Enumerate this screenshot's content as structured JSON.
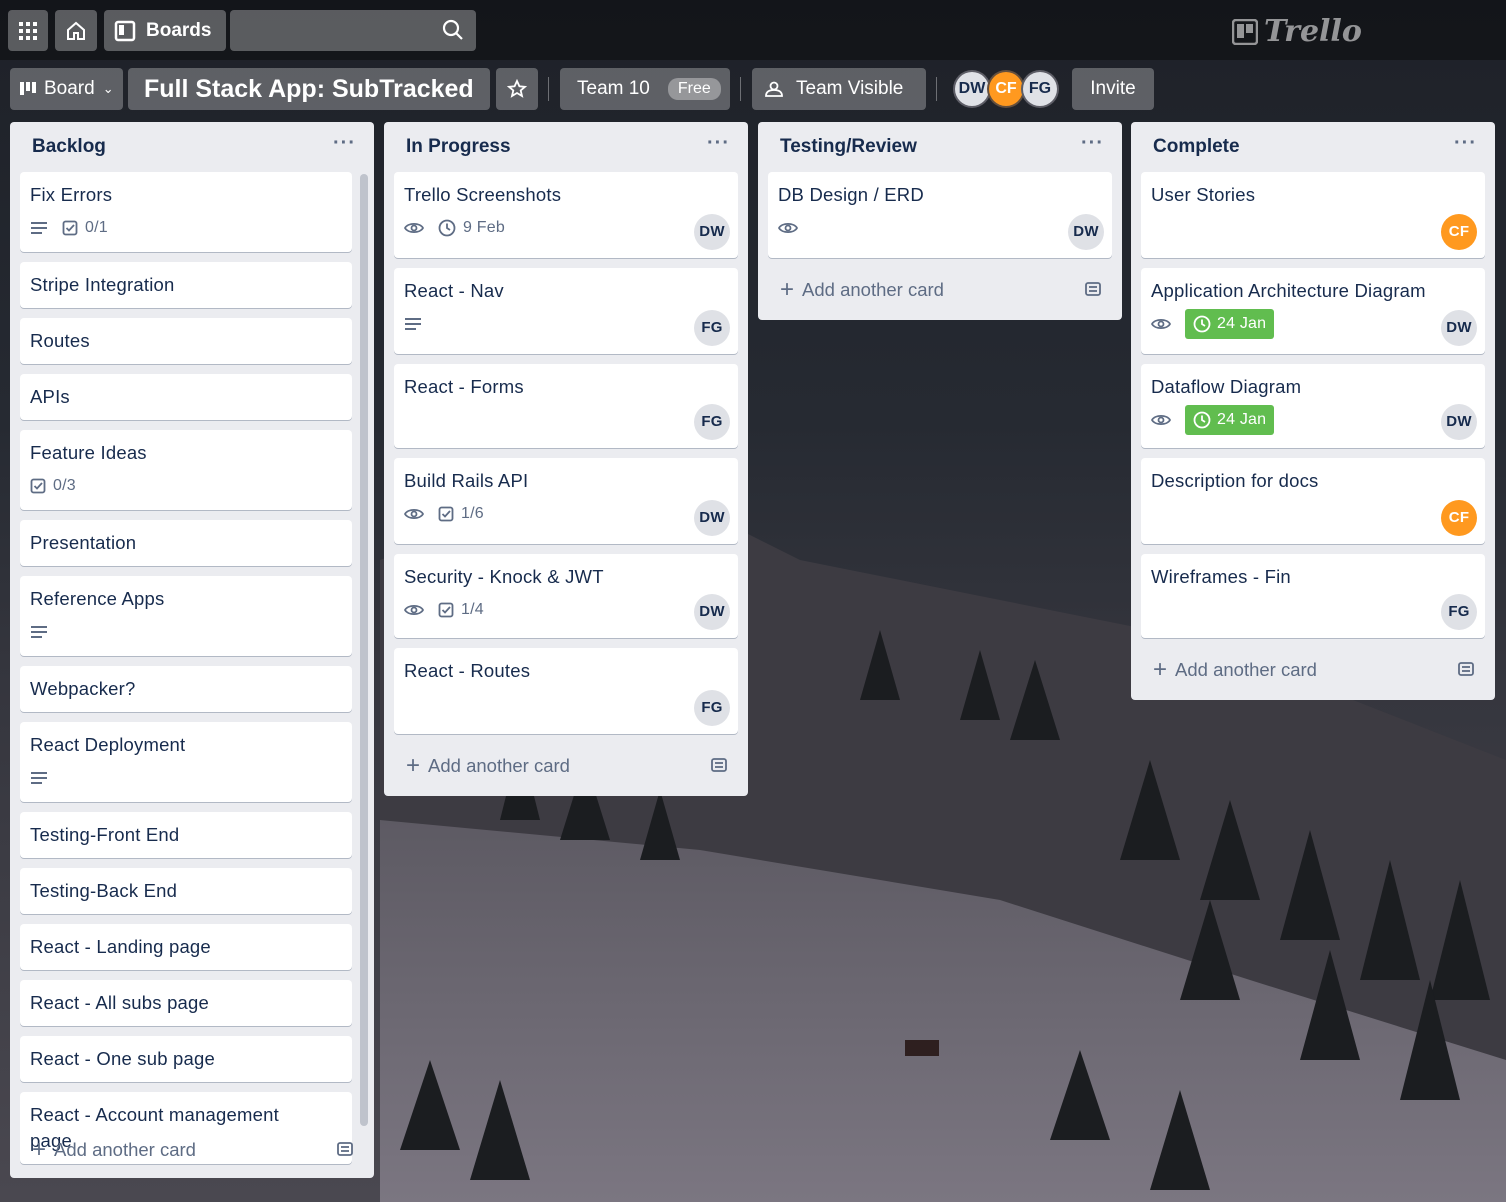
{
  "header": {
    "boards_label": "Boards",
    "search_placeholder": "",
    "logo_text": "Trello"
  },
  "board": {
    "view_label": "Board",
    "title": "Full Stack App: SubTracked",
    "team_name": "Team 10",
    "team_plan": "Free",
    "visibility": "Team Visible",
    "members": [
      "DW",
      "CF",
      "FG"
    ],
    "invite_label": "Invite"
  },
  "lists": [
    {
      "title": "Backlog",
      "add_label": "Add another card",
      "cards": [
        {
          "title": "Fix Errors",
          "description": true,
          "checklist": "0/1"
        },
        {
          "title": "Stripe Integration"
        },
        {
          "title": "Routes"
        },
        {
          "title": "APIs"
        },
        {
          "title": "Feature Ideas",
          "checklist": "0/3"
        },
        {
          "title": "Presentation"
        },
        {
          "title": "Reference Apps",
          "description": true
        },
        {
          "title": "Webpacker?"
        },
        {
          "title": "React Deployment",
          "description": true
        },
        {
          "title": "Testing-Front End"
        },
        {
          "title": "Testing-Back End"
        },
        {
          "title": "React - Landing page"
        },
        {
          "title": "React - All subs page"
        },
        {
          "title": "React - One sub page"
        },
        {
          "title": "React - Account management page"
        }
      ]
    },
    {
      "title": "In Progress",
      "add_label": "Add another card",
      "cards": [
        {
          "title": "Trello Screenshots",
          "watching": true,
          "due": "9 Feb",
          "member": "DW"
        },
        {
          "title": "React - Nav",
          "description": true,
          "member": "FG"
        },
        {
          "title": "React - Forms",
          "member": "FG"
        },
        {
          "title": "Build Rails API",
          "watching": true,
          "checklist": "1/6",
          "member": "DW"
        },
        {
          "title": "Security - Knock & JWT",
          "watching": true,
          "checklist": "1/4",
          "member": "DW"
        },
        {
          "title": "React - Routes",
          "member": "FG"
        }
      ]
    },
    {
      "title": "Testing/Review",
      "add_label": "Add another card",
      "cards": [
        {
          "title": "DB Design / ERD",
          "watching": true,
          "member": "DW"
        }
      ]
    },
    {
      "title": "Complete",
      "add_label": "Add another card",
      "cards": [
        {
          "title": "User Stories",
          "member": "CF"
        },
        {
          "title": "Application Architecture Diagram",
          "watching": true,
          "due_complete": "24 Jan",
          "member": "DW"
        },
        {
          "title": "Dataflow Diagram",
          "watching": true,
          "due_complete": "24 Jan",
          "member": "DW"
        },
        {
          "title": "Description for docs",
          "member": "CF"
        },
        {
          "title": "Wireframes - Fin",
          "member": "FG"
        }
      ]
    }
  ],
  "colors": {
    "due_complete": "#61bd4f",
    "avatar_cf": "#ff991f",
    "list_bg": "#ebecf0"
  }
}
